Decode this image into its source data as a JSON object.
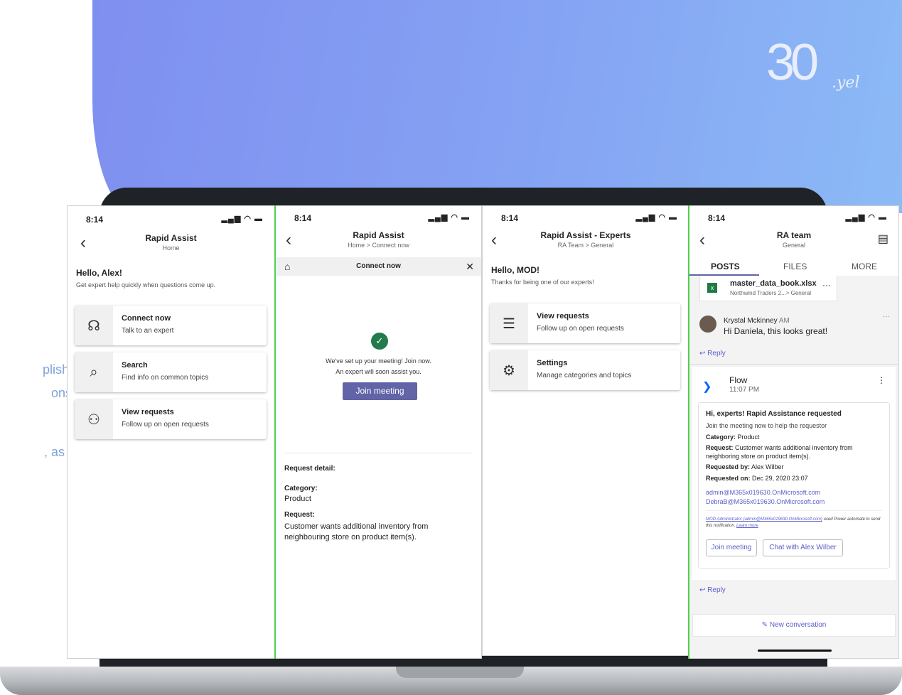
{
  "brand": {
    "logo_big": "30",
    "logo_small": ".yel",
    "accent": "#6264a7"
  },
  "side_text": [
    "plished",
    "onse",
    ", as a"
  ],
  "phone1": {
    "time": "8:14",
    "title": "Rapid Assist",
    "subtitle": "Home",
    "greeting": "Hello, Alex!",
    "greeting_sub": "Get expert help quickly when questions come up.",
    "cards": [
      {
        "title": "Connect now",
        "sub": "Talk to an expert",
        "icon": "headset-icon"
      },
      {
        "title": "Search",
        "sub": "Find info on common topics",
        "icon": "search-icon"
      },
      {
        "title": "View requests",
        "sub": "Follow up on open requests",
        "icon": "people-icon"
      }
    ]
  },
  "phone2": {
    "time": "8:14",
    "title": "Rapid Assist",
    "subtitle": "Home > Connect now",
    "tab": "Connect now",
    "msg1": "We've set up your meeting! Join now.",
    "msg2": "An expert will soon assist you.",
    "join": "Join meeting",
    "detail_label": "Request detail:",
    "category_label": "Category:",
    "category": "Product",
    "request_label": "Request:",
    "request": "Customer wants additional inventory from neighbouring store on product item(s)."
  },
  "phone3": {
    "time": "8:14",
    "title": "Rapid Assist - Experts",
    "subtitle": "RA Team > General",
    "greeting": "Hello, MOD!",
    "greeting_sub": "Thanks for being one of our experts!",
    "cards": [
      {
        "title": "View requests",
        "sub": "Follow up on open requests",
        "icon": "list-icon"
      },
      {
        "title": "Settings",
        "sub": "Manage categories and topics",
        "icon": "gear-icon"
      }
    ]
  },
  "phone4": {
    "time": "8:14",
    "title": "RA team",
    "subtitle": "General",
    "tabs": [
      "POSTS",
      "FILES",
      "MORE"
    ],
    "file_name": "master_data_book.xlsx",
    "file_path": "Northwind Traders 2...> General",
    "author": "Krystal Mckinney",
    "author_time": "AM",
    "author_msg": "Hi Daniela, this looks great!",
    "reply": "Reply",
    "flow_name": "Flow",
    "flow_time": "11:07 PM",
    "card_title": "Hi, experts! Rapid Assistance requested",
    "card_sub": "Join the meeting now to help the requestor",
    "category_label": "Category:",
    "category": "Product",
    "request_label": "Request:",
    "request": "Customer wants additional inventory from neighboring store on product item(s).",
    "requested_by_label": "Requested by:",
    "requested_by": "Alex Wilber",
    "requested_on_label": "Requested on:",
    "requested_on": "Dec 29, 2020 23:07",
    "email1": "admin@M365x019630.OnMicrosoft.com",
    "email2": "DebraB@M365x019630.OnMicrosoft.com",
    "footer_link": "MOD Administrator (admin@M365x019630.OnMicrosoft.com)",
    "footer_text": "used Power automate to send this notification.",
    "learn_more": "Learn more",
    "btn_join": "Join meeting",
    "btn_chat": "Chat with Alex Wilber",
    "reply2": "Reply",
    "new_conv": "New conversation"
  }
}
